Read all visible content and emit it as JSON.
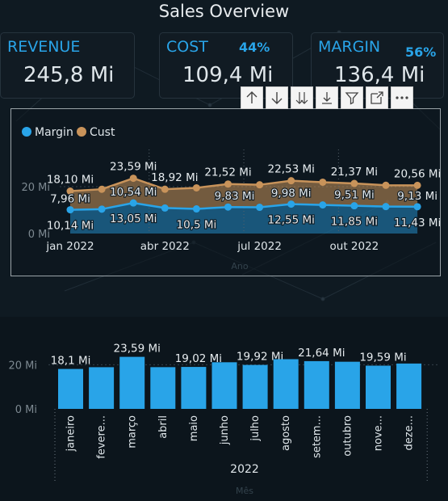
{
  "header": {
    "title": "Sales Overview"
  },
  "cards": {
    "revenue": {
      "label": "REVENUE",
      "value": "245,8 Mi"
    },
    "cost": {
      "label": "COST",
      "value": "109,4 Mi",
      "percent": "44%"
    },
    "margin": {
      "label": "MARGIN",
      "value": "136,4 Mi",
      "percent": "56%"
    }
  },
  "toolbar": {
    "icons": [
      "arrow-up-icon",
      "arrow-down-icon",
      "double-arrow-down-icon",
      "expand-hierarchy-icon",
      "filter-icon",
      "focus-mode-icon",
      "more-options-icon"
    ]
  },
  "colors": {
    "margin": "#29a4e8",
    "cost": "#c8935a",
    "accent": "#29a4e8"
  },
  "chart_data": [
    {
      "type": "area",
      "xlabel": "Ano",
      "ylabel": "",
      "x": [
        "2022-01",
        "2022-02",
        "2022-03",
        "2022-04",
        "2022-05",
        "2022-06",
        "2022-07",
        "2022-08",
        "2022-09",
        "2022-10",
        "2022-11",
        "2022-12"
      ],
      "x_tick_labels": [
        "jan 2022",
        "abr 2022",
        "jul 2022",
        "out 2022"
      ],
      "y_ticks": [
        "0 Mi",
        "20 Mi"
      ],
      "ylim": [
        0,
        40
      ],
      "legend": {
        "position": "top-left",
        "items": [
          "Margin",
          "Cust"
        ]
      },
      "series": [
        {
          "name": "Margin",
          "values": [
            10.14,
            10.4,
            13.05,
            10.9,
            10.5,
            11.3,
            11.2,
            12.55,
            12.2,
            11.85,
            11.5,
            11.43
          ],
          "labels": [
            "10,14 Mi",
            null,
            "13,05 Mi",
            null,
            "10,5 Mi",
            null,
            null,
            "12,55 Mi",
            null,
            "11,85 Mi",
            null,
            "11,43 Mi"
          ]
        },
        {
          "name": "Cust",
          "values": [
            7.96,
            8.5,
            10.54,
            8.0,
            9.0,
            9.83,
            9.6,
            9.98,
            9.7,
            9.51,
            9.1,
            9.13
          ],
          "labels": [
            "7,96 Mi",
            null,
            "10,54 Mi",
            null,
            null,
            "9,83 Mi",
            null,
            "9,98 Mi",
            null,
            "9,51 Mi",
            null,
            "9,13 Mi"
          ]
        }
      ],
      "totals": [
        18.1,
        18.9,
        23.59,
        18.92,
        19.5,
        21.13,
        20.8,
        22.53,
        21.9,
        21.37,
        20.6,
        20.56
      ],
      "total_labels": [
        "18,10 Mi",
        null,
        "23,59 Mi",
        "18,92 Mi",
        null,
        "21,52 Mi",
        null,
        "22,53 Mi",
        null,
        "21,37 Mi",
        null,
        "20,56 Mi"
      ]
    },
    {
      "type": "bar",
      "xlabel": "Mês",
      "year_label": "2022",
      "categories": [
        "janeiro",
        "fevere...",
        "março",
        "abril",
        "maio",
        "junho",
        "julho",
        "agosto",
        "setem...",
        "outubro",
        "nove...",
        "deze..."
      ],
      "values": [
        18.1,
        18.9,
        23.59,
        18.92,
        19.02,
        21.13,
        19.92,
        22.53,
        21.64,
        21.37,
        19.59,
        20.56
      ],
      "labels": [
        "18,1 Mi",
        null,
        "23,59 Mi",
        null,
        "19,02 Mi",
        null,
        "19,92 Mi",
        null,
        "21,64 Mi",
        null,
        "19,59 Mi",
        null
      ],
      "y_ticks": [
        "0 Mi",
        "20 Mi"
      ],
      "ylim": [
        0,
        40
      ]
    }
  ]
}
